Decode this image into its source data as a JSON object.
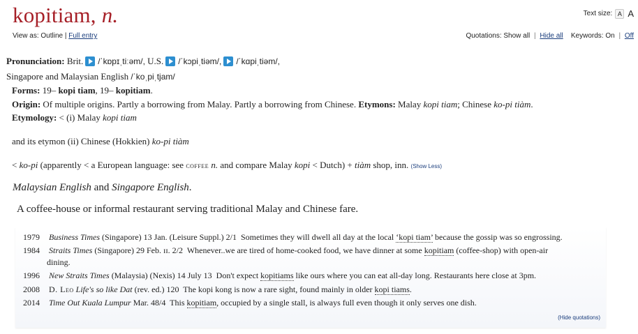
{
  "headword": {
    "word": "kopitiam,",
    "pos": "n."
  },
  "view_as": {
    "label": "View as:",
    "outline": "Outline",
    "sep": "|",
    "full_entry": "Full entry"
  },
  "text_size": {
    "label": "Text size:",
    "small": "A",
    "large": "A"
  },
  "quotations_bar": {
    "label": "Quotations:",
    "show_all": "Show all",
    "sep": "|",
    "hide_all": "Hide all"
  },
  "keywords_bar": {
    "label": "Keywords:",
    "on": "On",
    "sep": "|",
    "off": "Off"
  },
  "pronunciation": {
    "label": "Pronunciation:",
    "brit_label": "Brit.",
    "brit_ipa": "/ˈkɒpɪˌtiːəm/,",
    "us_label": "U.S.",
    "us_ipa_1": "/ˈkɔpiˌtiəm/,",
    "us_ipa_2": "/ˈkɑpiˌtiəm/,",
    "sing_label": "Singapore and Malaysian English",
    "sing_ipa": "/ˈkoˌpiˌtjam/"
  },
  "forms": {
    "label": "Forms:",
    "text_1": "19–",
    "form_1": "kopi tiam",
    "text_2": ", 19–",
    "form_2": "kopitiam",
    "end": "."
  },
  "origin": {
    "label": "Origin:",
    "text": "Of multiple origins. Partly a borrowing from Malay. Partly a borrowing from Chinese.",
    "etymons_label": "Etymons:",
    "etymons_text_1": "Malay",
    "etymon_1": "kopi tiam",
    "etymons_text_2": "; Chinese",
    "etymon_2": "ko-pi tiàm",
    "end": "."
  },
  "etymology": {
    "label": "Etymology:",
    "line1_pre": "< (i) Malay",
    "line1_word": "kopi tiam",
    "line2_pre": "and its etymon (ii) Chinese (Hokkien)",
    "line2_word": "ko-pi tiàm",
    "line3_lt": "<",
    "line3_w1": "ko-pi",
    "line3_t1": "(apparently < a European language: see",
    "line3_coffee": "coffee",
    "line3_n": "n.",
    "line3_t2": "and compare Malay",
    "line3_w2": "kopi",
    "line3_t3": "< Dutch) +",
    "line3_w3": "tiàm",
    "line3_t4": "shop, inn.",
    "show_less": "(Show Less)"
  },
  "usage": {
    "w1": "Malaysian English",
    "and": "and",
    "w2": "Singapore English",
    "end": "."
  },
  "definition": "A coffee-house or informal restaurant serving traditional Malay and Chinese fare.",
  "quotations": [
    {
      "year": "1979",
      "src": "Business Times",
      "src_rest": "(Singapore) 13 Jan. (Leisure Suppl.) 2/1",
      "pre": "Sometimes they will dwell all day at the local",
      "kw": "‘kopi tiam’",
      "post": "because the gossip was so engrossing."
    },
    {
      "year": "1984",
      "src": "Straits Times",
      "src_rest": "(Singapore) 29 Feb. ɪɪ. 2/2",
      "pre": "Whenever..we are tired of home-cooked food, we have dinner at some",
      "kw": "kopitiam",
      "post": "(coffee-shop) with open-air",
      "cont": "dining."
    },
    {
      "year": "1996",
      "src": "New Straits Times",
      "src_rest": "(Malaysia) (Nexis) 14 July 13",
      "pre": "Don't expect",
      "kw": "kopitiams",
      "post": "like ours where you can eat all-day long. Restaurants here close at 3pm."
    },
    {
      "year": "2008",
      "author": "D. Leo",
      "src": "Life's so like Dat",
      "src_rest": "(rev. ed.) 120",
      "pre": "The kopi kong is now a rare sight, found mainly in older",
      "kw": "kopi tiams",
      "post": "."
    },
    {
      "year": "2014",
      "src": "Time Out Kuala Lumpur",
      "src_rest": "Mar. 48/4",
      "pre": "This",
      "kw": "kopitiam",
      "post": ", occupied by a single stall, is always full even though it only serves one dish."
    }
  ],
  "hide_quotations": "(Hide quotations)",
  "colors": {
    "headword": "#a61f27",
    "link": "#1a3d7c",
    "audio": "#2d8fd0"
  },
  "icons": {
    "audio": "play-audio-icon"
  }
}
